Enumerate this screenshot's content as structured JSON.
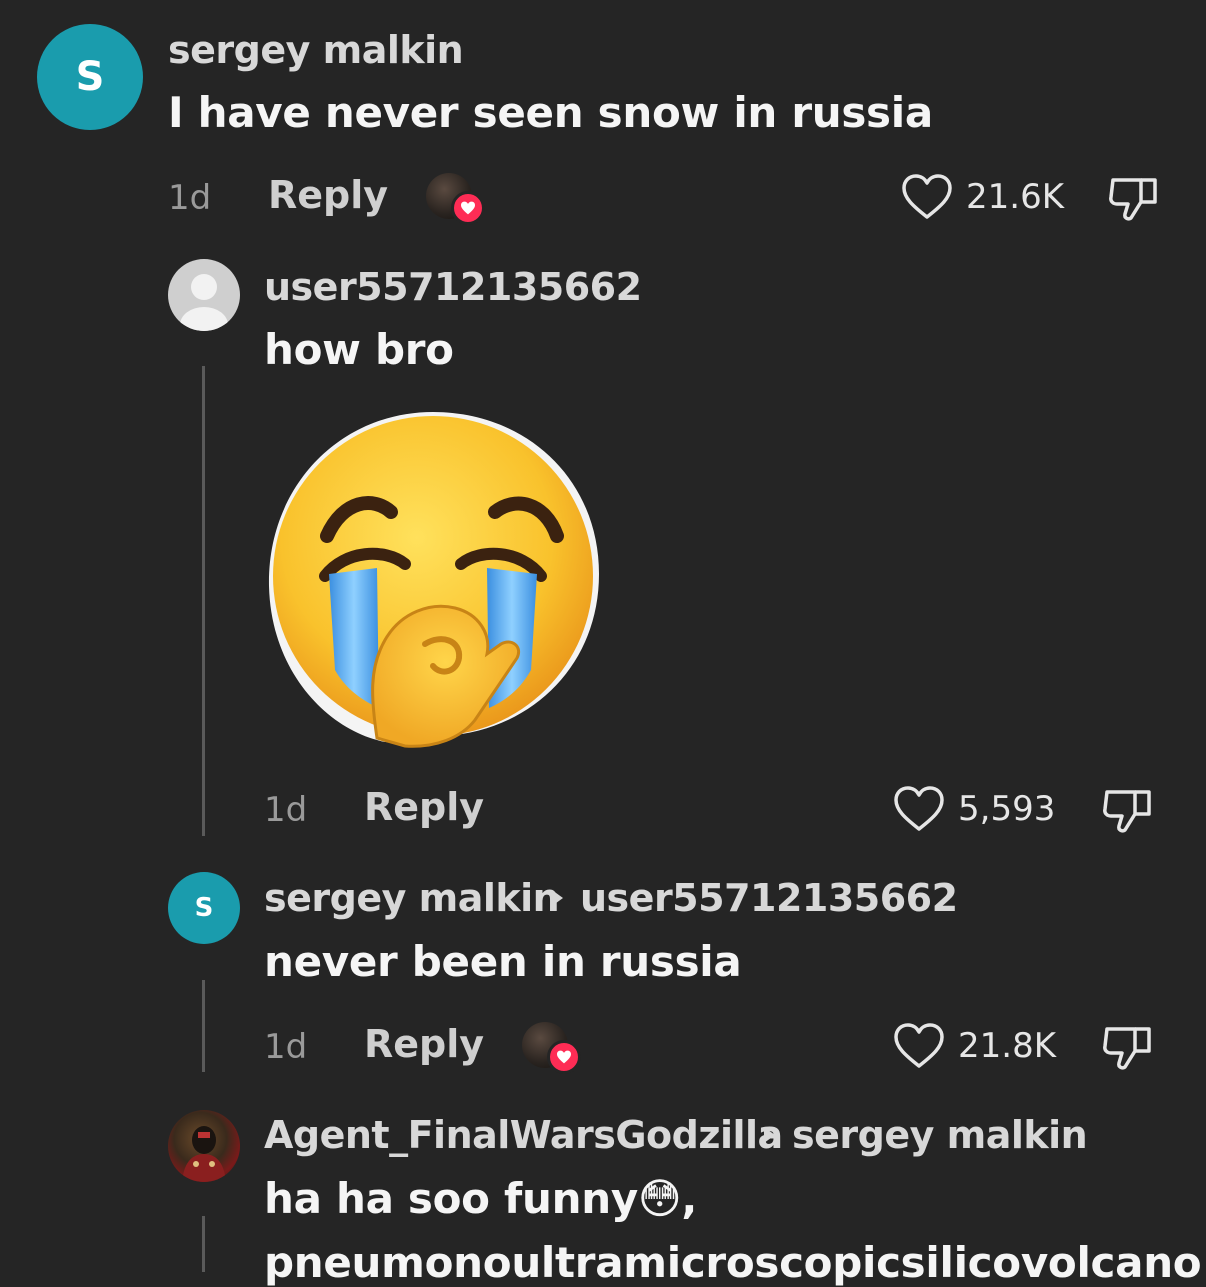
{
  "comments": [
    {
      "username": "sergey malkin",
      "avatar_letter": "S",
      "text": "I have never seen snow in russia",
      "age": "1d",
      "reply_label": "Reply",
      "likes": "21.6K",
      "liked_by_creator": true
    },
    {
      "username": "user55712135662",
      "text": "how bro",
      "sticker": "loudly-crying-emoji-sticker",
      "age": "1d",
      "reply_label": "Reply",
      "likes": "5,593"
    },
    {
      "username": "sergey malkin",
      "avatar_letter": "S",
      "reply_to": "user55712135662",
      "text": "never been in russia",
      "age": "1d",
      "reply_label": "Reply",
      "likes": "21.8K",
      "liked_by_creator": true
    },
    {
      "username": "Agent_FinalWarsGodzilla",
      "reply_to": "sergey malkin",
      "text_line1": "ha ha soo funny",
      "text_line1_emoji": "😳",
      "text_line1_suffix": ",",
      "text_line2": "pneumonoultramicroscopicsilicovolcano"
    }
  ],
  "colors": {
    "background": "#252525",
    "avatar_teal": "#1a9cad",
    "heart_badge": "#fe2c55"
  },
  "icons": [
    "heart-outline-icon",
    "dislike-icon",
    "reply-arrow-icon",
    "creator-heart-badge-icon"
  ]
}
